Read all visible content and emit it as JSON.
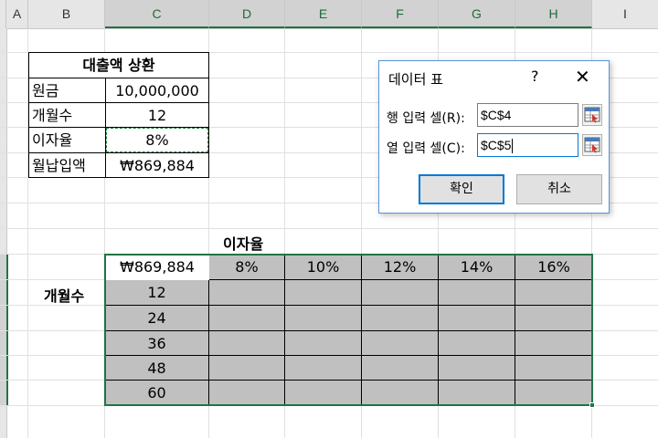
{
  "column_headers": [
    "A",
    "B",
    "C",
    "D",
    "E",
    "F",
    "G",
    "H",
    "I"
  ],
  "loan_table": {
    "title": "대출액 상환",
    "rows": [
      {
        "label": "원금",
        "value": "10,000,000"
      },
      {
        "label": "개월수",
        "value": "12"
      },
      {
        "label": "이자율",
        "value": "8%"
      },
      {
        "label": "월납입액",
        "value": "₩869,884"
      }
    ]
  },
  "data_table": {
    "row_header": "이자율",
    "col_header": "개월수",
    "corner": "₩869,884",
    "rates": [
      "8%",
      "10%",
      "12%",
      "14%",
      "16%"
    ],
    "months": [
      "12",
      "24",
      "36",
      "48",
      "60"
    ]
  },
  "dialog": {
    "title": "데이터 표",
    "help": "?",
    "close": "✕",
    "row_input_label": "행 입력 셀(R):",
    "row_input_value": "$C$4",
    "col_input_label": "열 입력 셀(C):",
    "col_input_value": "$C$5",
    "ok": "확인",
    "cancel": "취소"
  },
  "colors": {
    "accent": "#217346",
    "selection_fill": "#c0c0c0",
    "dialog_border": "#5a93d4",
    "focus": "#0078d7"
  }
}
